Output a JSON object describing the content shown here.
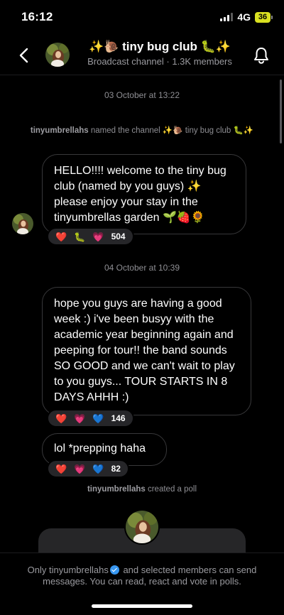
{
  "status_bar": {
    "time": "16:12",
    "network": "4G",
    "battery": "36"
  },
  "header": {
    "title": "✨🐌 tiny bug club 🐛✨",
    "channel_type": "Broadcast channel",
    "separator": " · ",
    "members": "1.3K members"
  },
  "messages": {
    "date1": "03 October at 13:22",
    "rename_user": "tinyumbrellahs",
    "rename_text": " named the channel ✨🐌 tiny bug club 🐛✨",
    "msg1_text": "HELLO!!!! welcome to the tiny bug club (named by you guys) ✨ please enjoy your stay in the tinyumbrellas garden 🌱🍓🌻",
    "msg1_reactions": {
      "e1": "❤️",
      "e2": "🐛",
      "e3": "💗",
      "count": "504"
    },
    "date2": "04 October at 10:39",
    "msg2_text": "hope you guys are having a good week :) i've been busyy with the academic year beginning again and peeping for tour!! the band sounds SO GOOD and we can't wait to play to you guys... TOUR STARTS IN 8 DAYS AHHH :)",
    "msg2_reactions": {
      "e1": "❤️",
      "e2": "💗",
      "e3": "💙",
      "count": "146"
    },
    "msg3_text": "lol *prepping haha",
    "msg3_reactions": {
      "e1": "❤️",
      "e2": "💗",
      "e3": "💙",
      "count": "82"
    },
    "poll_user": "tinyumbrellahs",
    "poll_text": " created a poll"
  },
  "footer": {
    "prefix": "Only tinyumbrellahs",
    "suffix": " and selected members can send messages. You can read, react and vote in polls."
  },
  "colors": {
    "accent": "#3897f0",
    "battery": "#d9e021",
    "bubble_border": "#38383a",
    "reaction_bg": "#262629"
  }
}
